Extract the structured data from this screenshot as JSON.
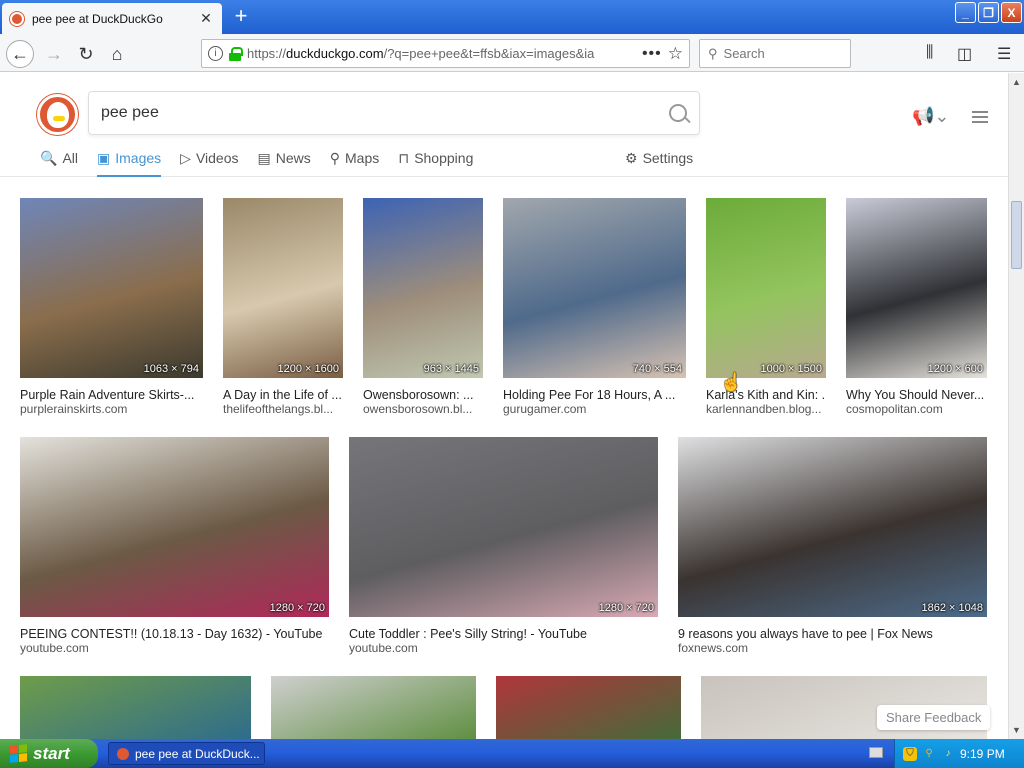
{
  "browser": {
    "tab_title": "pee pee at DuckDuckGo",
    "tab_close": "✕",
    "new_tab": "+",
    "url_prefix": "https://",
    "url_domain": "duckduckgo.com",
    "url_rest": "/?q=pee+pee&t=ffsb&iax=images&ia",
    "search_placeholder": "Search",
    "window_buttons": [
      "_",
      "❐",
      "X"
    ]
  },
  "ddg": {
    "query": "pee pee",
    "tabs": [
      {
        "label": "All",
        "icon": "search-icon",
        "glyph": "🔍"
      },
      {
        "label": "Images",
        "icon": "image-icon",
        "glyph": "▣"
      },
      {
        "label": "Videos",
        "icon": "play-icon",
        "glyph": "▷"
      },
      {
        "label": "News",
        "icon": "newspaper-icon",
        "glyph": "▤"
      },
      {
        "label": "Maps",
        "icon": "map-pin-icon",
        "glyph": "⚲"
      },
      {
        "label": "Shopping",
        "icon": "shopping-bag-icon",
        "glyph": "⊓"
      }
    ],
    "settings_label": "Settings",
    "active_tab": "Images"
  },
  "results": {
    "row1": [
      {
        "title": "Purple Rain Adventure Skirts-...",
        "source": "purplerainskirts.com",
        "dims": "1063 × 794",
        "colors": [
          "#6f86b8",
          "#8a6d4c",
          "#3c3a2e"
        ]
      },
      {
        "title": "A Day in the Life of ...",
        "source": "thelifeofthelangs.bl...",
        "dims": "1200 × 1600",
        "colors": [
          "#9a8868",
          "#d7c9ae",
          "#7a5e44"
        ]
      },
      {
        "title": "Owensborosown: ...",
        "source": "owensborosown.bl...",
        "dims": "963 × 1445",
        "colors": [
          "#3d63b4",
          "#9e8e7b",
          "#c0c8b0"
        ]
      },
      {
        "title": "Holding Pee For 18 Hours, A ...",
        "source": "gurugamer.com",
        "dims": "740 × 554",
        "colors": [
          "#a1a7ad",
          "#4f6a8b",
          "#d7c2b2"
        ]
      },
      {
        "title": "Karla's Kith and Kin: ...",
        "source": "karlennandben.blog...",
        "dims": "1000 × 1500",
        "colors": [
          "#6cab3a",
          "#93c45e",
          "#b8a890"
        ]
      },
      {
        "title": "Why You Should Never...",
        "source": "cosmopolitan.com",
        "dims": "1200 × 600",
        "colors": [
          "#c9ccd8",
          "#2f3135",
          "#e6e2dc"
        ]
      }
    ],
    "row2": [
      {
        "title": "PEEING CONTEST!! (10.18.13 - Day 1632) - YouTube",
        "source": "youtube.com",
        "dims": "1280 × 720",
        "colors": [
          "#e4e2dc",
          "#6b5a45",
          "#b0285a"
        ]
      },
      {
        "title": "Cute Toddler : Pee's Silly String! - YouTube",
        "source": "youtube.com",
        "dims": "1280 × 720",
        "colors": [
          "#76767a",
          "#5e5d60",
          "#d8a9b4"
        ]
      },
      {
        "title": "9 reasons you always have to pee | Fox News",
        "source": "foxnews.com",
        "dims": "1862 × 1048",
        "colors": [
          "#dfe0e2",
          "#3a3330",
          "#4d6b8a"
        ]
      }
    ],
    "row3": [
      {
        "colors": [
          "#6f9c4a",
          "#2b6a8f"
        ]
      },
      {
        "colors": [
          "#cfcfcf",
          "#5a8c3a"
        ]
      },
      {
        "colors": [
          "#b0353a",
          "#3f6e3a"
        ]
      },
      {
        "colors": [
          "#c8c3bc",
          "#e9e6e1"
        ]
      }
    ]
  },
  "share_feedback": "Share Feedback",
  "taskbar": {
    "start_label": "start",
    "task_label": "pee pee at DuckDuck...",
    "clock": "9:19 PM"
  }
}
